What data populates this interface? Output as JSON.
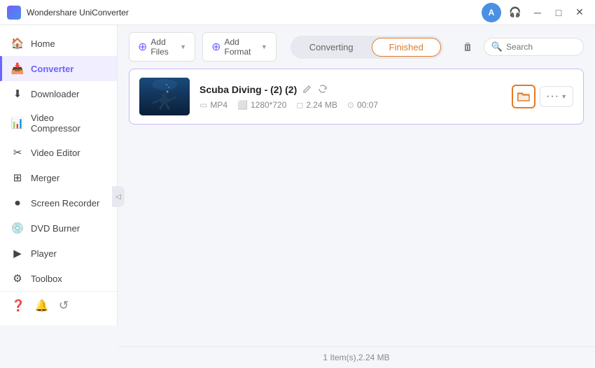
{
  "app": {
    "title": "Wondershare UniConverter",
    "logo_text": "W"
  },
  "titlebar": {
    "avatar_label": "A",
    "minimize": "─",
    "maximize": "□",
    "close": "✕",
    "headphone_icon": "headphone-icon",
    "minimize_icon": "minimize-icon",
    "maximize_icon": "maximize-icon",
    "close_icon": "close-icon"
  },
  "sidebar": {
    "items": [
      {
        "id": "home",
        "label": "Home",
        "icon": "🏠"
      },
      {
        "id": "converter",
        "label": "Converter",
        "icon": "📥",
        "active": true
      },
      {
        "id": "downloader",
        "label": "Downloader",
        "icon": "⬇"
      },
      {
        "id": "video-compressor",
        "label": "Video Compressor",
        "icon": "📊"
      },
      {
        "id": "video-editor",
        "label": "Video Editor",
        "icon": "✂"
      },
      {
        "id": "merger",
        "label": "Merger",
        "icon": "⊞"
      },
      {
        "id": "screen-recorder",
        "label": "Screen Recorder",
        "icon": "⏺"
      },
      {
        "id": "dvd-burner",
        "label": "DVD Burner",
        "icon": "💿"
      },
      {
        "id": "player",
        "label": "Player",
        "icon": "▶"
      },
      {
        "id": "toolbox",
        "label": "Toolbox",
        "icon": "⚙"
      }
    ],
    "bottom": {
      "help_icon": "❓",
      "notification_icon": "🔔",
      "feedback_icon": "↺"
    }
  },
  "toolbar": {
    "add_file_label": "Add Files",
    "add_format_label": "Add Format",
    "tab_converting": "Converting",
    "tab_finished": "Finished",
    "trash_icon": "trash-icon",
    "search_placeholder": "Search"
  },
  "file_item": {
    "name": "Scuba Diving - (2) (2)",
    "format": "MP4",
    "resolution": "1280*720",
    "size": "2.24 MB",
    "duration": "00:07",
    "edit_icon": "edit-icon",
    "refresh_icon": "refresh-icon",
    "folder_icon": "folder-icon",
    "more_icon": "more-icon",
    "chevron_icon": "chevron-down-icon"
  },
  "statusbar": {
    "text": "1 Item(s),2.24 MB"
  }
}
